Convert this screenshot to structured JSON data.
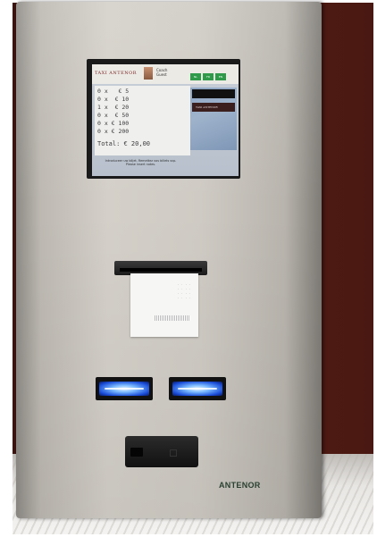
{
  "screen": {
    "logo": "TAXI ANTENOR",
    "user_line1": "Coach",
    "user_line2": "Guest",
    "buttons": [
      "NL",
      "FR",
      "EN"
    ],
    "denominations": [
      "0 x   € 5",
      "0 x  € 10",
      "1 x  € 20",
      "0 x  € 50",
      "0 x € 100",
      "0 x € 200"
    ],
    "total": "Total: € 20,00",
    "note": "Introduceer uw biljet. Remettez vos billets svp. Please insert notes.",
    "slot_logo": "TAXI ANTENOR"
  },
  "ticket": {
    "lines": "\n  · ·  · ·\n  · ·  · ·\n  · ·  · ·\n  · ·  · ·"
  },
  "brand": {
    "name": "ANTENOR",
    "color": "#2a4030"
  },
  "acceptor_glow_color": "#3a7bff"
}
